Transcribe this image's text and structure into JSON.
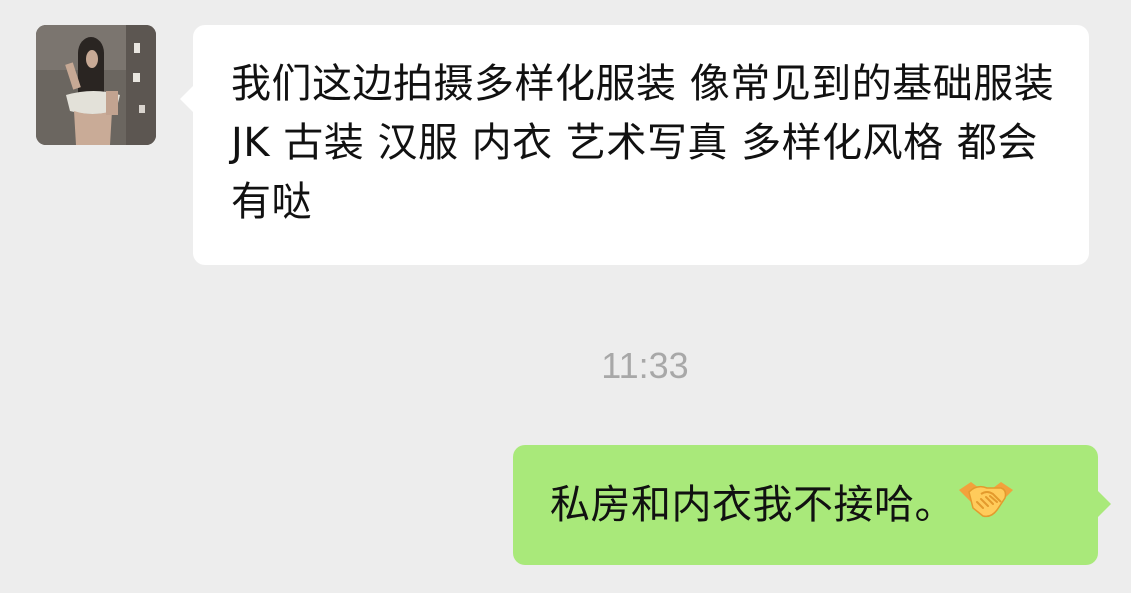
{
  "chat": {
    "incoming": {
      "text": "我们这边拍摄多样化服装 像常见到的基础服装 JK 古装 汉服 内衣 艺术写真 多样化风格 都会有哒",
      "avatar_icon": "contact-avatar-photo"
    },
    "timestamp": "11:33",
    "outgoing": {
      "text": "私房和内衣我不接哈。",
      "emoji_icon": "handshake-emoji"
    }
  },
  "colors": {
    "background": "#ededed",
    "incoming_bubble": "#ffffff",
    "outgoing_bubble": "#a9e97a",
    "timestamp": "#a8a8a8"
  }
}
